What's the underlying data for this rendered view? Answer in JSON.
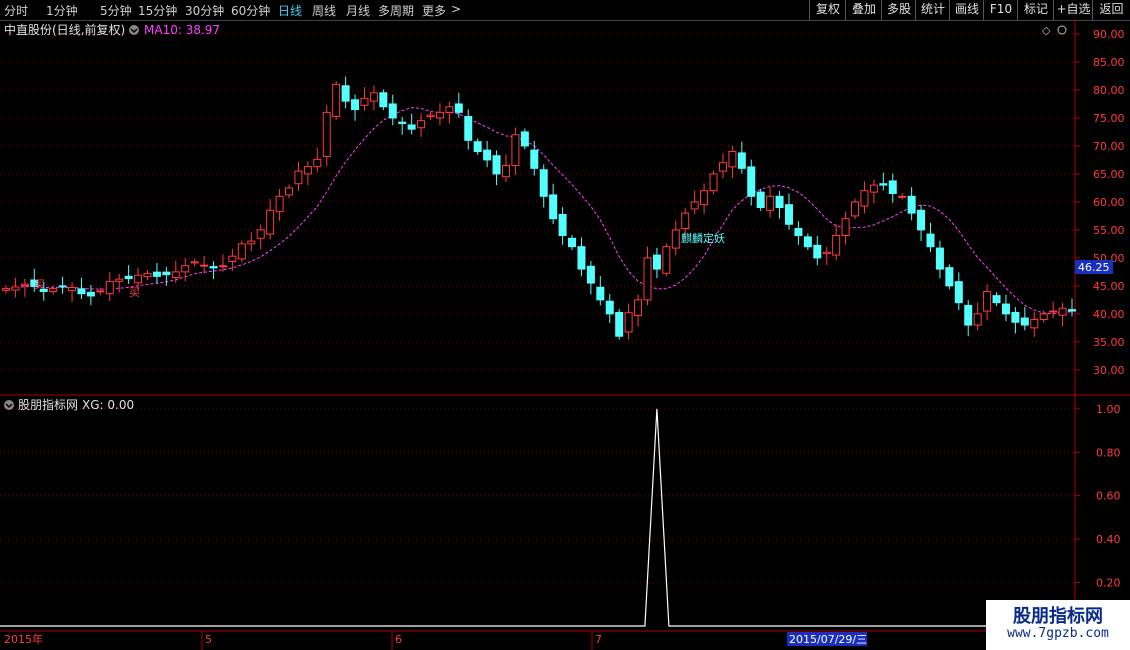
{
  "toolbar": {
    "periods": [
      "分时",
      "1分钟",
      "5分钟",
      "15分钟",
      "30分钟",
      "60分钟",
      "日线",
      "周线",
      "月线",
      "多周期",
      "更多"
    ],
    "active_period": "日线",
    "more_arrow": ">",
    "right_buttons": [
      "复权",
      "叠加",
      "多股",
      "统计",
      "画线",
      "F10",
      "标记",
      "+自选",
      "返回"
    ]
  },
  "main_panel": {
    "title": "中直股份(日线,前复权)",
    "ma_label": "MA10: 38.97",
    "current_price": "46.25",
    "buy_marker": "买",
    "event_label": "麒麟定妖",
    "diamond": "◇"
  },
  "indicator_panel": {
    "name": "股朋指标网",
    "value_label": "XG: 0.00"
  },
  "date_axis": {
    "labels": [
      "2015年",
      "5",
      "6",
      "7"
    ],
    "highlight": "2015/07/29/三"
  },
  "watermark": {
    "line1": "股朋指标网",
    "line2": "www.7gpzb.com"
  },
  "colors": {
    "up": "#ff3b3b",
    "down": "#54ffff",
    "ma": "#ff40ff",
    "axis": "#b00000",
    "grid": "#800000",
    "price_tag_bg": "#1a2fc0"
  },
  "chart_data": [
    {
      "type": "candlestick",
      "title": "中直股份(日线,前复权)",
      "y_ticks": [
        30,
        35,
        40,
        45,
        50,
        55,
        60,
        65,
        70,
        75,
        80,
        85,
        90
      ],
      "ylim": [
        25.5,
        92.5
      ],
      "grid": true,
      "current_price": 46.25,
      "series_close": [
        44.5,
        44.8,
        45.3,
        44.9,
        44.0,
        44.5,
        44.9,
        44.7,
        43.6,
        43.2,
        44.1,
        45.8,
        46.2,
        46.3,
        46.9,
        47.2,
        46.7,
        47.0,
        47.5,
        48.6,
        49.3,
        48.7,
        48.2,
        48.6,
        50.3,
        52.5,
        53.0,
        55.0,
        58.5,
        61.0,
        62.5,
        65.5,
        66.3,
        67.6,
        76.0,
        81.0,
        78.0,
        76.5,
        78.5,
        79.5,
        77.0,
        75.0,
        74.0,
        73.0,
        74.5,
        75.5,
        76.0,
        77.0,
        76.0,
        71.0,
        69.0,
        67.5,
        65.0,
        66.5,
        72.0,
        70.0,
        66.0,
        61.0,
        57.0,
        54.0,
        52.0,
        48.0,
        45.5,
        42.5,
        40.0,
        36.0,
        40.2,
        42.5,
        50.0,
        48.0,
        52.0,
        55.0,
        58.0,
        60.0,
        62.0,
        65.0,
        67.0,
        69.0,
        66.0,
        61.0,
        59.0,
        61.0,
        59.0,
        56.0,
        54.0,
        52.0,
        50.0,
        51.0,
        54.0,
        57.0,
        60.0,
        62.0,
        63.0,
        63.0,
        61.5,
        61.0,
        58.0,
        55.0,
        52.0,
        48.0,
        45.0,
        42.0,
        38.0,
        40.0,
        44.0,
        42.0,
        40.0,
        38.5,
        38.0,
        39.0,
        40.0,
        40.5,
        41.0,
        40.5
      ],
      "ma_period": 10,
      "ma_value": 38.97
    },
    {
      "type": "line",
      "title": "股朋指标网",
      "series": [
        {
          "name": "XG",
          "peak_index": 69,
          "peak_value": 1.0,
          "baseline": 0.0
        }
      ],
      "y_ticks": [
        0.2,
        0.4,
        0.6,
        0.8,
        1.0
      ],
      "ylim": [
        0.0,
        1.05
      ],
      "current": "XG: 0.00"
    }
  ]
}
